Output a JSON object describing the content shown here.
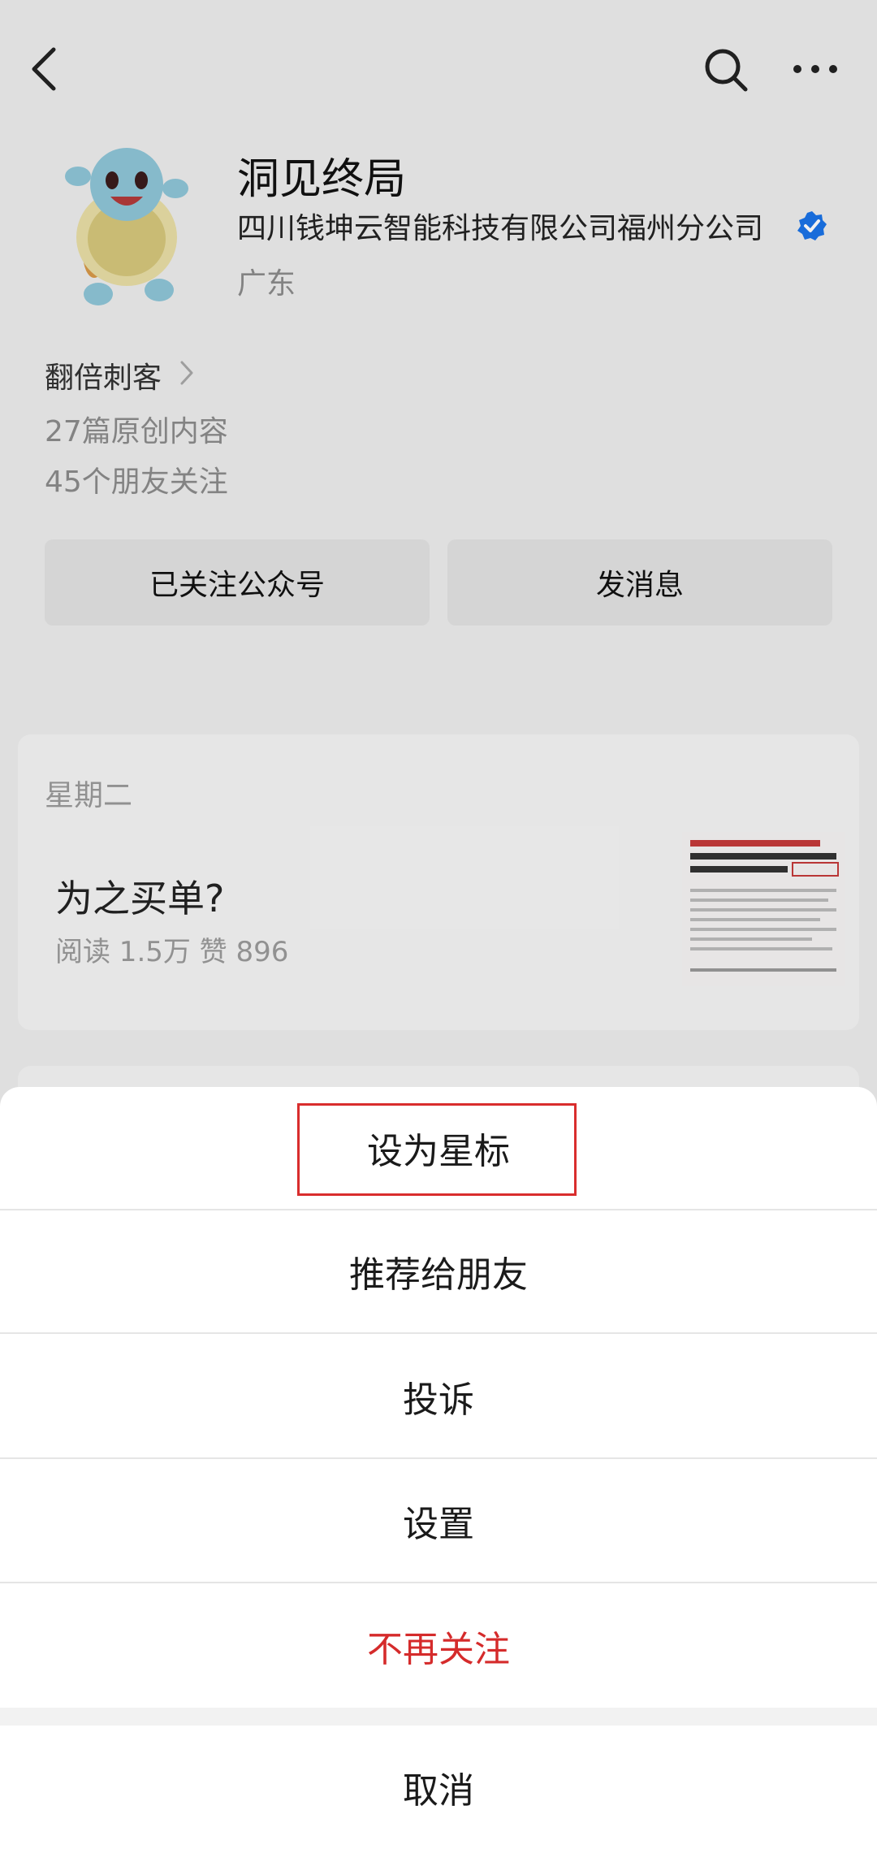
{
  "header": {
    "back_icon": "chevron-left-icon",
    "search_icon": "search-icon",
    "more_icon": "more-icon"
  },
  "profile": {
    "name": "洞见终局",
    "company": "四川钱坤云智能科技有限公司福州分公司",
    "location": "广东",
    "verified_color": "#1a73e8",
    "sub_name": "翻倍刺客",
    "original_count": "27篇原创内容",
    "friends_following": "45个朋友关注"
  },
  "actions": {
    "follow_label": "已关注公众号",
    "message_label": "发消息"
  },
  "article": {
    "day": "星期二",
    "title": "为之买单?",
    "stats": "阅读 1.5万   赞 896"
  },
  "sheet": {
    "items": [
      {
        "label": "设为星标"
      },
      {
        "label": "推荐给朋友"
      },
      {
        "label": "投诉"
      },
      {
        "label": "设置"
      },
      {
        "label": "不再关注",
        "color": "#d52b2b"
      }
    ],
    "cancel_label": "取消",
    "highlight_color": "#d92d2d"
  }
}
